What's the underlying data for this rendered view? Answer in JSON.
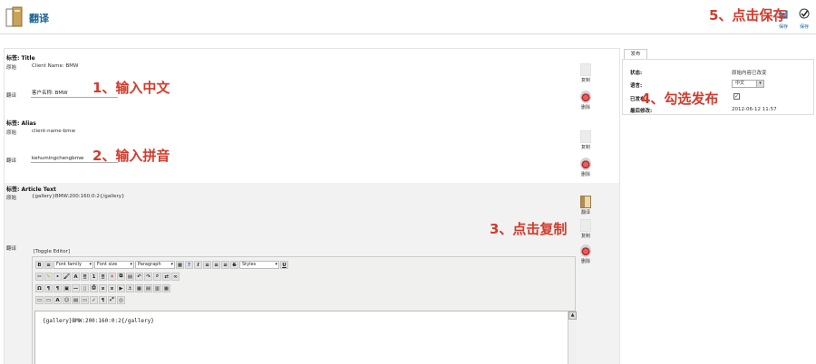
{
  "header": {
    "title": "翻译",
    "save_label_1": "保存",
    "save_label_2": "保存"
  },
  "fields": [
    {
      "header": "标签: Title",
      "original_label": "原始",
      "original_value": "Client Name: BMW",
      "translation_label": "翻译",
      "translation_value": "客户名称: BMW"
    },
    {
      "header": "标签: Alias",
      "original_label": "原始",
      "original_value": "client-name-bmw",
      "translation_label": "翻译",
      "translation_value": "kehumingchengbmw"
    },
    {
      "header": "标签: Article Text",
      "original_label": "原始",
      "original_value": "{gallery}BMW:200:160:0:2{/gallery}",
      "translation_label": "翻译"
    }
  ],
  "actions": {
    "copy": "复制",
    "delete": "删除",
    "translate": "翻译"
  },
  "editor": {
    "toggle": "[Toggle Editor]",
    "font_family": "Font family",
    "font_size": "Font size",
    "format": "Paragraph",
    "styles": "Styles",
    "content": "{gallery}BMW:200:160:0:2{/gallery}"
  },
  "right_panel": {
    "tab": "发布",
    "status_label": "状态:",
    "status_value": "原始内容已改变",
    "language_label": "语言:",
    "language_value": "中文",
    "published_label": "已发布:",
    "modified_label": "最后修改:",
    "modified_value": "2012-06-12 11:57"
  },
  "annotations": {
    "a1": "1、输入中文",
    "a2": "2、输入拼音",
    "a3": "3、点击复制",
    "a4": "4、勾选发布",
    "a5": "5、点击保存"
  },
  "colors": {
    "annotation": "#d33a2c",
    "title": "#146295"
  }
}
